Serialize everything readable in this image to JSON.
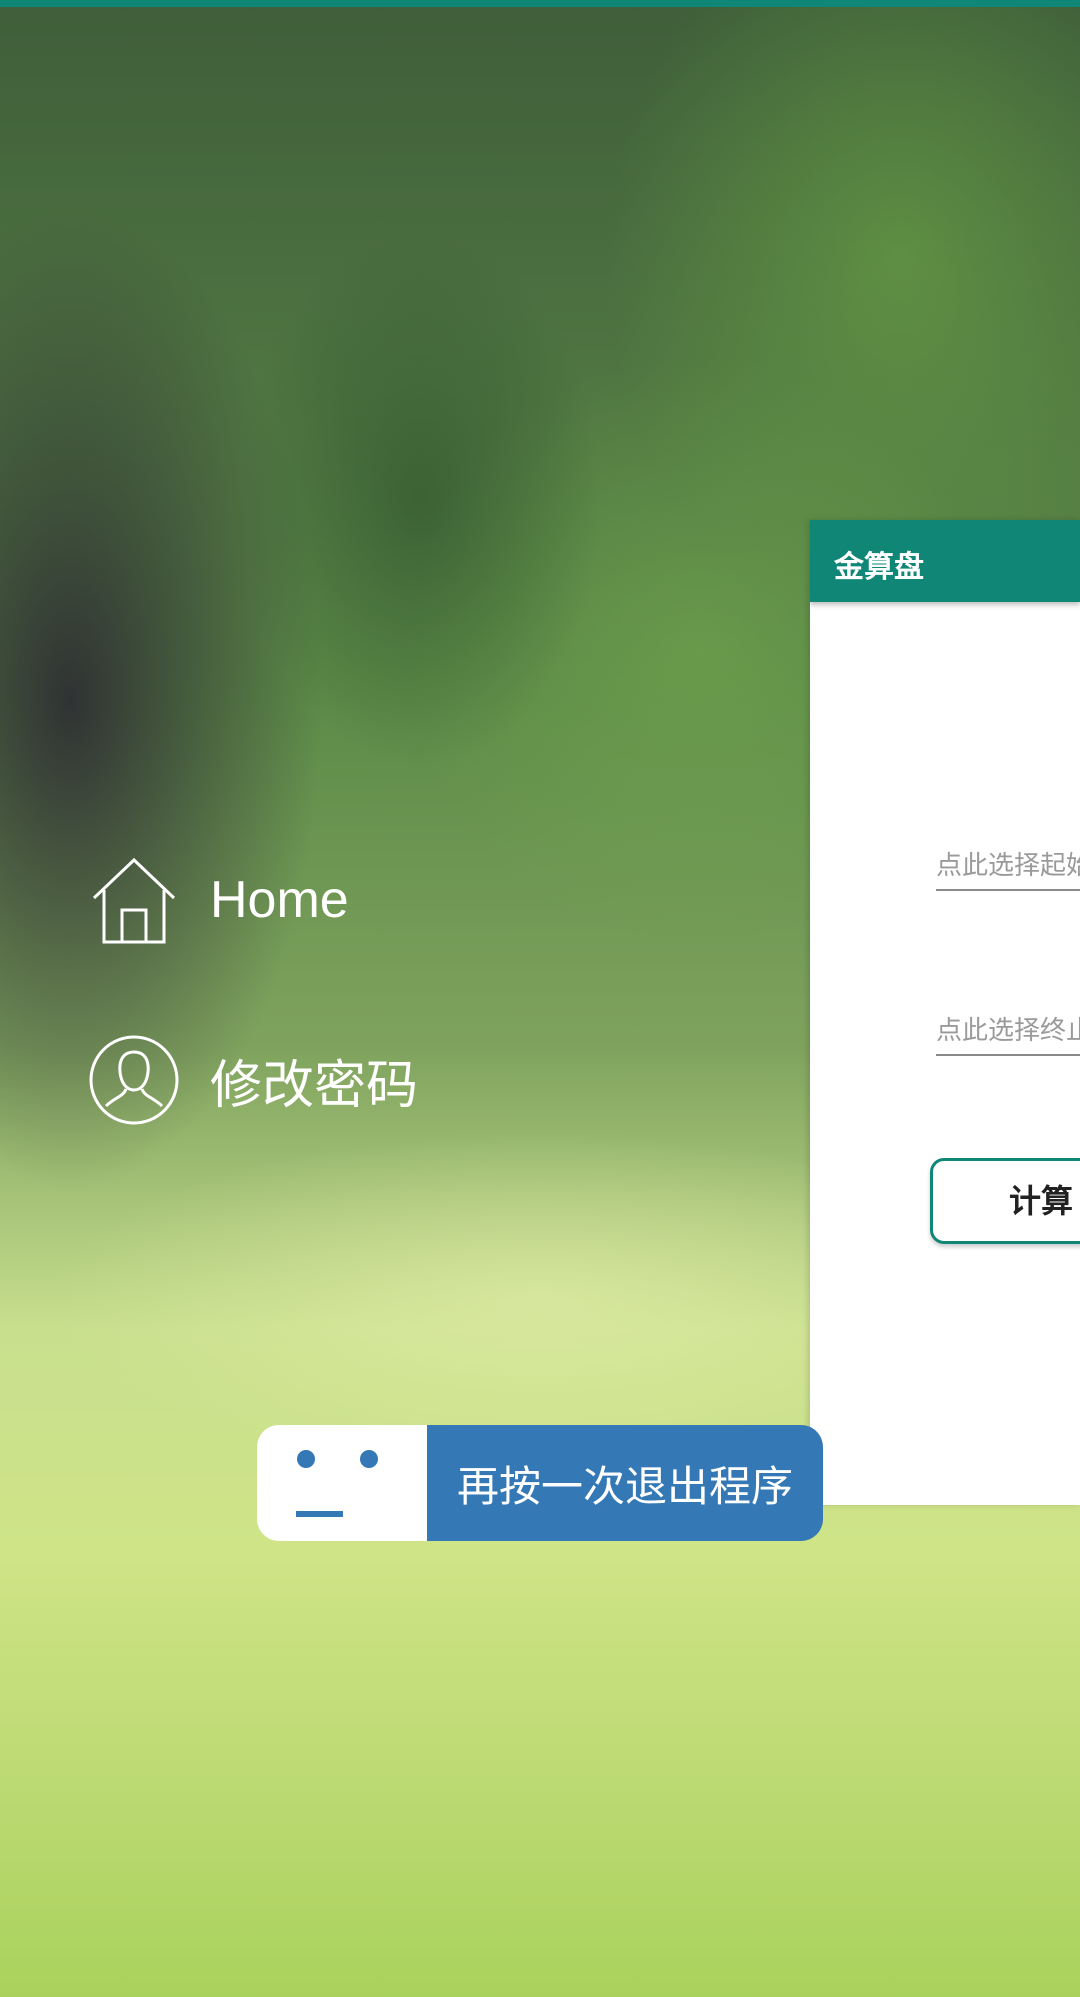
{
  "drawer": {
    "items": [
      {
        "label": "Home",
        "icon": "home-icon"
      },
      {
        "label": "修改密码",
        "icon": "user-icon"
      }
    ]
  },
  "panel": {
    "title": "金算盘",
    "start_date_placeholder": "点此选择起始日期",
    "end_date_placeholder": "点此选择终止日期",
    "calculate_label": "计算"
  },
  "toast": {
    "message": "再按一次退出程序",
    "icon": "face-icon"
  },
  "colors": {
    "accent": "#0f8676",
    "toast_blue": "#3478b6"
  }
}
